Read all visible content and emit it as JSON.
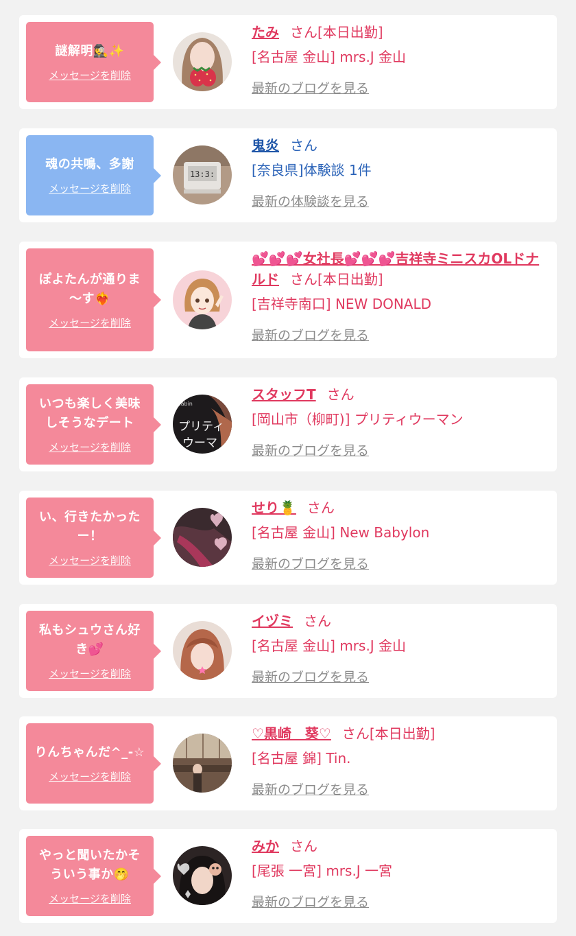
{
  "delete_label": "メッセージを削除",
  "colors": {
    "pink_bubble": "#f4899a",
    "blue_bubble": "#8ab6f2",
    "pink_text": "#e0395f",
    "blue_text": "#2b63b8",
    "link_gray": "#8c8c8c"
  },
  "items": [
    {
      "message": "謎解明🕵‍♀️✨",
      "name": "たみ",
      "honorific": "さん",
      "status": "[本日出勤]",
      "shop": "[名古屋 金山] mrs.J 金山",
      "link": "最新のブログを見る"
    },
    {
      "message": "魂の共鳴、多謝",
      "name": "鬼炎",
      "honorific": "さん",
      "status": "",
      "shop": "[奈良県]体験談 1件",
      "link": "最新の体験談を見る"
    },
    {
      "message": "ぽよたんが通りま～す❤️‍🔥",
      "name": "💕💕💕女社長💕💕💕吉祥寺ミニスカOLドナルド",
      "honorific": "さん",
      "status": "[本日出勤]",
      "shop": "[吉祥寺南口] NEW DONALD",
      "link": "最新のブログを見る"
    },
    {
      "message": "いつも楽しく美味しそうなデート",
      "name": "スタッフT",
      "honorific": "さん",
      "status": "",
      "shop": "[岡山市（柳町)] プリティウーマン",
      "link": "最新のブログを見る"
    },
    {
      "message": "い、行きたかったー！",
      "name": "せり🍍",
      "honorific": "さん",
      "status": "",
      "shop": "[名古屋 金山] New Babylon",
      "link": "最新のブログを見る"
    },
    {
      "message": "私もシュウさん好き💕",
      "name": "イヅミ",
      "honorific": "さん",
      "status": "",
      "shop": "[名古屋 金山] mrs.J 金山",
      "link": "最新のブログを見る"
    },
    {
      "message": "りんちゃんだ^_-☆",
      "name": "♡黒崎　葵♡",
      "honorific": "さん",
      "status": "[本日出勤]",
      "shop": "[名古屋 錦] Tin.",
      "link": "最新のブログを見る"
    },
    {
      "message": "やっと聞いたかそういう事か🤭",
      "name": "みか",
      "honorific": "さん",
      "status": "",
      "shop": "[尾張 一宮] mrs.J 一宮",
      "link": "最新のブログを見る"
    }
  ]
}
